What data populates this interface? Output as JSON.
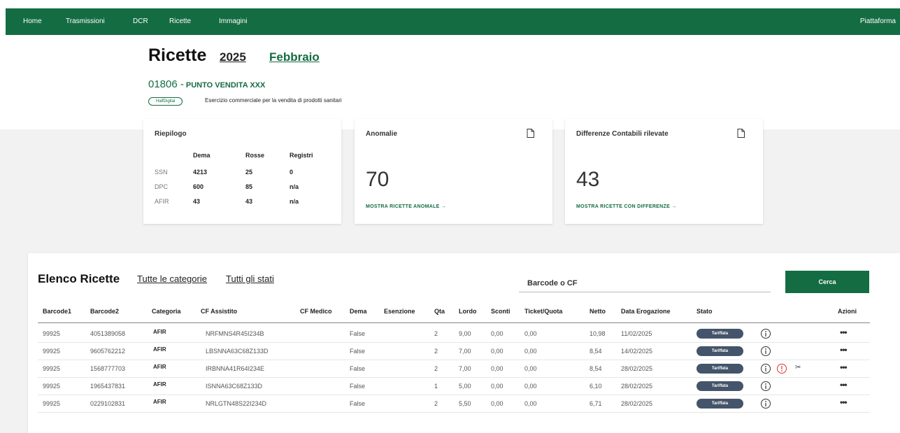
{
  "nav": {
    "items": [
      "Home",
      "Trasmissioni",
      "DCR",
      "Ricette",
      "Immagini"
    ],
    "right": "Piattaforma"
  },
  "header": {
    "title": "Ricette",
    "year": "2025",
    "month": "Febbraio",
    "store_code": "01806 -",
    "store_name": "PUNTO VENDITA XXX",
    "store_badge": "HalfDigital",
    "store_description": "Esercizio commerciale per la vendita di prodotti sanitari"
  },
  "riepilogo": {
    "title": "Riepilogo",
    "columns": [
      "Dema",
      "Rosse",
      "Registri"
    ],
    "rows": [
      {
        "label": "SSN",
        "dema": "4213",
        "rosse": "25",
        "registri": "0"
      },
      {
        "label": "DPC",
        "dema": "600",
        "rosse": "85",
        "registri": "n/a"
      },
      {
        "label": "AFIR",
        "dema": "43",
        "rosse": "43",
        "registri": "n/a"
      }
    ]
  },
  "anomalie": {
    "title": "Anomalie",
    "value": "70",
    "link": "MOSTRA RICETTE ANOMALE →",
    "icon": "document-icon"
  },
  "differenze": {
    "title": "Differenze Contabili rilevate",
    "value": "43",
    "link": "MOSTRA RICETTE CON DIFFERENZE →",
    "icon": "document-icon"
  },
  "list": {
    "title": "Elenco Ricette",
    "filter_categories": "Tutte le categorie",
    "filter_states": "Tutti gli stati",
    "search_placeholder": "Barcode o CF",
    "search_button": "Cerca",
    "columns": [
      "Barcode1",
      "Barcode2",
      "Categoria",
      "CF Assistito",
      "CF Medico",
      "Dema",
      "Esenzione",
      "Qta",
      "Lordo",
      "Sconti",
      "Ticket/Quota",
      "Netto",
      "Data Erogazione",
      "Stato",
      "Azioni"
    ],
    "rows": [
      {
        "barcode1": "99925",
        "barcode2": "4051389058",
        "categoria": "AFIR",
        "cf_assistito": "NRFMNS4R45I234B",
        "cf_medico": "",
        "dema": "False",
        "esenzione": "",
        "qta": "2",
        "lordo": "9,00",
        "sconti": "0,00",
        "ticket": "0,00",
        "netto": "10,98",
        "data": "11/02/2025",
        "stato": "Tariffata",
        "alert": false
      },
      {
        "barcode1": "99925",
        "barcode2": "9605762212",
        "categoria": "AFIR",
        "cf_assistito": "LBSNNA63C68Z133D",
        "cf_medico": "",
        "dema": "False",
        "esenzione": "",
        "qta": "2",
        "lordo": "7,00",
        "sconti": "0,00",
        "ticket": "0,00",
        "netto": "8,54",
        "data": "14/02/2025",
        "stato": "Tariffata",
        "alert": false
      },
      {
        "barcode1": "99925",
        "barcode2": "1568777703",
        "categoria": "AFIR",
        "cf_assistito": "IRBNNA41R64I234E",
        "cf_medico": "",
        "dema": "False",
        "esenzione": "",
        "qta": "2",
        "lordo": "7,00",
        "sconti": "0,00",
        "ticket": "0,00",
        "netto": "8,54",
        "data": "28/02/2025",
        "stato": "Tariffata",
        "alert": true
      },
      {
        "barcode1": "99925",
        "barcode2": "1965437831",
        "categoria": "AFIR",
        "cf_assistito": "ISNNA63C68Z133D",
        "cf_medico": "",
        "dema": "False",
        "esenzione": "",
        "qta": "1",
        "lordo": "5,00",
        "sconti": "0,00",
        "ticket": "0,00",
        "netto": "6,10",
        "data": "28/02/2025",
        "stato": "Tariffata",
        "alert": false
      },
      {
        "barcode1": "99925",
        "barcode2": "0229102831",
        "categoria": "AFIR",
        "cf_assistito": "NRLGTN48S22I234D",
        "cf_medico": "",
        "dema": "False",
        "esenzione": "",
        "qta": "2",
        "lordo": "5,50",
        "sconti": "0,00",
        "ticket": "0,00",
        "netto": "6,71",
        "data": "28/02/2025",
        "stato": "Tariffata",
        "alert": false
      }
    ],
    "actions_label": "•••"
  },
  "colors": {
    "brand": "#146c43",
    "status_badge": "#44546a",
    "alert": "#e03131"
  }
}
